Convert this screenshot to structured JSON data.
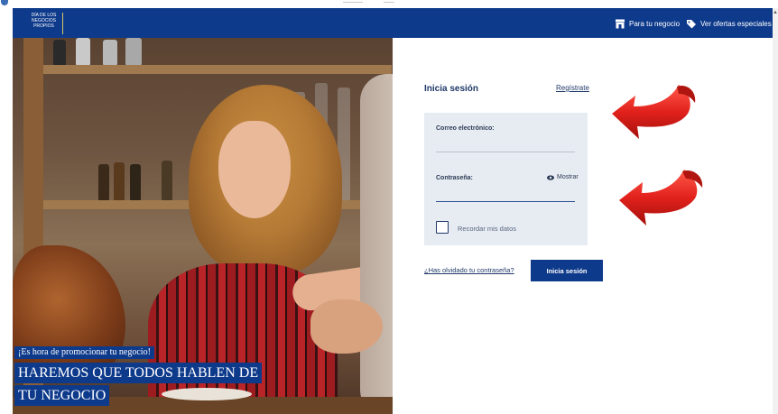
{
  "header": {
    "logo_lines": [
      "DÍA DE LOS",
      "NEGOCIOS",
      "PROPIOS"
    ],
    "business_link": "Para tu negocio",
    "offers_link": "Ver ofertas especiales",
    "business_icon": "storefront-icon",
    "offers_icon": "tag-icon"
  },
  "hero": {
    "tagline": "¡Es hora de promocionar tu negocio!",
    "headline_line1": "HAREMOS QUE TODOS HABLEN DE",
    "headline_line2": "TU NEGOCIO"
  },
  "login": {
    "title": "Inicia sesión",
    "register_link": "Regístrate",
    "email_label": "Correo electrónico:",
    "email_value": "",
    "password_label": "Contraseña:",
    "password_value": "",
    "show_password": "Mostrar",
    "remember_label": "Recordar mis datos",
    "remember_checked": false,
    "forgot_link": "¿Has olvidado tu contraseña?",
    "submit_label": "Inicia sesión"
  },
  "colors": {
    "brand_blue": "#0e3a8b",
    "panel_bg": "#e7ecf2",
    "arrow_red": "#e2211c"
  }
}
